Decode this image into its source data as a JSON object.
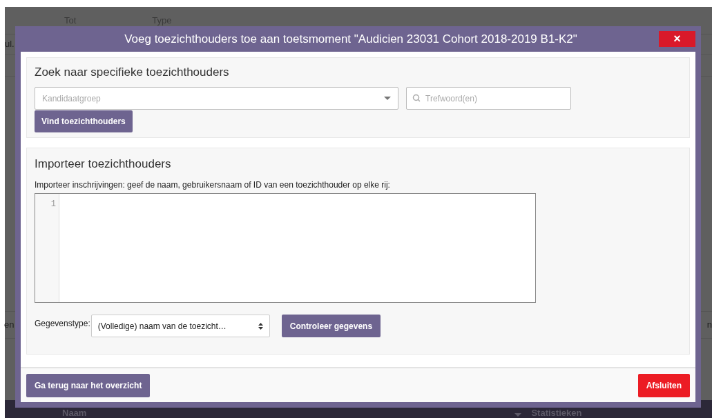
{
  "background": {
    "header_columns": [
      "Tot",
      "Type"
    ],
    "row_fragments": [
      "ul.",
      "en",
      "n"
    ],
    "footer_columns": [
      "Naam",
      "Statistieken"
    ]
  },
  "dialog": {
    "title": "Voeg toezichthouders toe aan toetsmoment \"Audicien 23031 Cohort 2018-2019 B1-K2\"",
    "close": "×",
    "search": {
      "heading": "Zoek naar specifieke toezichthouders",
      "group_select": {
        "placeholder": "Kandidaatgroep"
      },
      "keyword_field": {
        "placeholder": "Trefwoord(en)"
      },
      "button": "Vind toezichthouders"
    },
    "import": {
      "heading": "Importeer toezichthouders",
      "instruction": "Importeer inschrijvingen: geef de naam, gebruikersnaam of ID van een toezichthouder op elke rij:",
      "line_numbers": [
        "1"
      ],
      "data_type_label": "Gegevenstype:",
      "data_type_value": "(Volledige) naam van de toezicht…",
      "button": "Controleer gegevens"
    },
    "footer": {
      "back_button": "Ga terug naar het overzicht",
      "close_button": "Afsluiten"
    }
  }
}
